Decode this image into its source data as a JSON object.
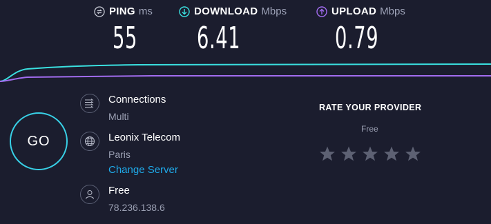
{
  "metrics": {
    "ping": {
      "label": "PING",
      "unit": "ms",
      "value": "55",
      "icon": "ping-icon"
    },
    "download": {
      "label": "DOWNLOAD",
      "unit": "Mbps",
      "value": "6.41",
      "icon": "download-icon"
    },
    "upload": {
      "label": "UPLOAD",
      "unit": "Mbps",
      "value": "0.79",
      "icon": "upload-icon"
    }
  },
  "colors": {
    "background": "#1b1d2e",
    "download_accent": "#3ae0e0",
    "upload_accent": "#a26cf0",
    "link": "#1fa9e8"
  },
  "go_button": {
    "label": "GO"
  },
  "connections": {
    "title": "Connections",
    "value": "Multi",
    "icon": "connections-icon"
  },
  "server": {
    "title": "Leonix Telecom",
    "location": "Paris",
    "change_link": "Change Server",
    "icon": "globe-icon"
  },
  "user": {
    "title": "Free",
    "ip": "78.236.138.6",
    "icon": "user-icon"
  },
  "rating": {
    "title": "RATE YOUR PROVIDER",
    "provider": "Free",
    "stars": 5,
    "selected": 0
  }
}
